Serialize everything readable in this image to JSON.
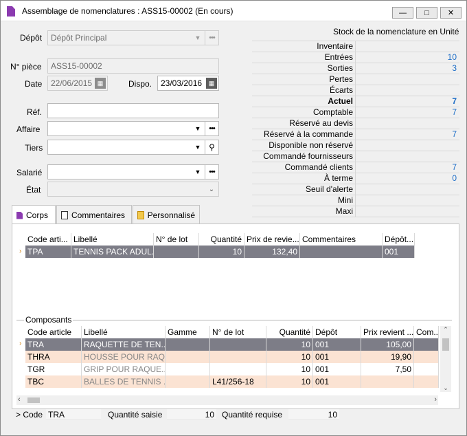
{
  "window": {
    "title": "Assemblage de nomenclatures : ASS15-00002 (En cours)"
  },
  "form": {
    "depot_label": "Dépôt",
    "depot_value": "Dépôt Principal",
    "piece_label": "N° pièce",
    "piece_value": "ASS15-00002",
    "date_label": "Date",
    "date_value": "22/06/2015",
    "dispo_label": "Dispo.",
    "dispo_value": "23/03/2016",
    "ref_label": "Réf.",
    "ref_value": "",
    "affaire_label": "Affaire",
    "affaire_value": "",
    "tiers_label": "Tiers",
    "tiers_value": "",
    "salarie_label": "Salarié",
    "salarie_value": "",
    "etat_label": "État",
    "etat_value": ""
  },
  "stock": {
    "heading": "Stock de la nomenclature en Unité",
    "rows": [
      {
        "label": "Inventaire",
        "value": ""
      },
      {
        "label": "Entrées",
        "value": "10"
      },
      {
        "label": "Sorties",
        "value": "3"
      },
      {
        "label": "Pertes",
        "value": ""
      },
      {
        "label": "Écarts",
        "value": ""
      },
      {
        "label": "Actuel",
        "value": "7"
      },
      {
        "label": "Comptable",
        "value": "7"
      },
      {
        "label": "Réservé au devis",
        "value": ""
      },
      {
        "label": "Réservé à la commande",
        "value": "7"
      },
      {
        "label": "Disponible non réservé",
        "value": ""
      },
      {
        "label": "Commandé fournisseurs",
        "value": ""
      },
      {
        "label": "Commandé clients",
        "value": "7"
      },
      {
        "label": "À terme",
        "value": "0"
      },
      {
        "label": "Seuil d'alerte",
        "value": ""
      },
      {
        "label": "Mini",
        "value": ""
      },
      {
        "label": "Maxi",
        "value": ""
      }
    ]
  },
  "tabs": {
    "corps": "Corps",
    "commentaires": "Commentaires",
    "personnalise": "Personnalisé"
  },
  "corps_grid": {
    "headers": [
      "Code arti...",
      "Libellé",
      "N° de lot",
      "Quantité",
      "Prix de revie...",
      "Commentaires",
      "Dépôt..."
    ],
    "rows": [
      [
        "TPA",
        "TENNIS PACK ADUL...",
        "",
        "10",
        "132,40",
        "",
        "001"
      ]
    ]
  },
  "composants": {
    "title": "Composants",
    "headers": [
      "Code article",
      "Libellé",
      "Gamme",
      "N° de lot",
      "Quantité",
      "Dépôt",
      "Prix revient ...",
      "Com..."
    ],
    "rows": [
      [
        "TRA",
        "RAQUETTE DE TEN...",
        "",
        "",
        "10",
        "001",
        "105,00",
        ""
      ],
      [
        "THRA",
        "HOUSSE POUR RAQ...",
        "",
        "",
        "10",
        "001",
        "19,90",
        ""
      ],
      [
        "TGR",
        "GRIP POUR RAQUE...",
        "",
        "",
        "10",
        "001",
        "7,50",
        ""
      ],
      [
        "TBC",
        "BALLES DE TENNIS ...",
        "",
        "L41/256-18",
        "10",
        "001",
        "",
        ""
      ]
    ]
  },
  "footer": {
    "code_label": "> Code",
    "code_value": "TRA",
    "qte_saisie_label": "Quantité saisie",
    "qte_saisie_value": "10",
    "qte_requise_label": "Quantité requise",
    "qte_requise_value": "10"
  },
  "colors": {
    "accent_link": "#1c6dc7",
    "selected_row": "#7d7d87",
    "alt_row": "#fbe3d3",
    "app_icon": "#8b3ab0"
  }
}
